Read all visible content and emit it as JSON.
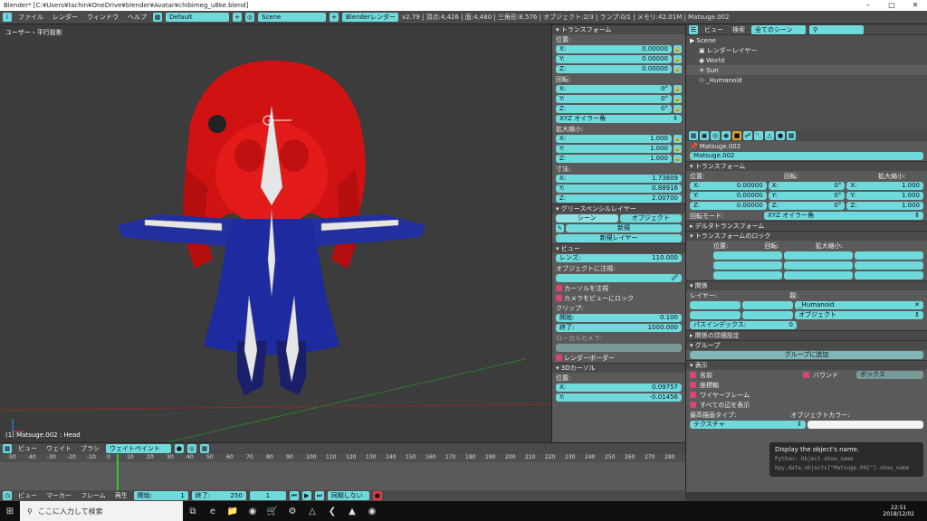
{
  "window": {
    "title": "Blender* [C:¥Users¥tachin¥OneDrive¥blender¥Avatar¥chibimeg_u8ke.blend]"
  },
  "topbar": {
    "menus": [
      "ファイル",
      "レンダー",
      "ウィンドウ",
      "ヘルプ"
    ],
    "layout": "Default",
    "scene": "Scene",
    "engine": "Blenderレンダー",
    "stats": "v2.79 | 頂点:4,426 | 面:4,480 | 三角形:8,576 | オブジェクト:2/3 | ランプ:0/1 | メモリ:42.01M | Matsuge.002"
  },
  "viewport": {
    "label": "ユーザー・平行投影",
    "object": "(1) Matsuge.002 : Head"
  },
  "npanel": {
    "transform_title": "トランスフォーム",
    "location_label": "位置:",
    "location": [
      {
        "axis": "X:",
        "value": "0.00000"
      },
      {
        "axis": "Y:",
        "value": "0.00000"
      },
      {
        "axis": "Z:",
        "value": "0.00000"
      }
    ],
    "rotation_label": "回転:",
    "rotation": [
      {
        "axis": "X:",
        "value": "0°"
      },
      {
        "axis": "Y:",
        "value": "0°"
      },
      {
        "axis": "Z:",
        "value": "0°"
      }
    ],
    "rotation_mode": "XYZ オイラー角",
    "scale_label": "拡大縮小:",
    "scale": [
      {
        "axis": "X:",
        "value": "1.000"
      },
      {
        "axis": "Y:",
        "value": "1.000"
      },
      {
        "axis": "Z:",
        "value": "1.000"
      }
    ],
    "dim_label": "寸法:",
    "dims": [
      {
        "axis": "X:",
        "value": "1.73809"
      },
      {
        "axis": "Y:",
        "value": "0.88916"
      },
      {
        "axis": "Z:",
        "value": "2.00700"
      }
    ],
    "gp_title": "グリースペンシルレイヤー",
    "gp_tabs": [
      "シーン",
      "オブジェクト"
    ],
    "gp_new": "新規",
    "gp_new_layer": "新規レイヤー",
    "view_title": "ビュー",
    "lens_label": "レンズ:",
    "lens_value": "110.000",
    "focus_label": "オブジェクトに注視:",
    "lock_cursor": "カーソルを注視",
    "lock_camera": "カメラをビューにロック",
    "clip_label": "クリップ:",
    "clip_start_label": "開始:",
    "clip_start": "0.100",
    "clip_end_label": "終了:",
    "clip_end": "1000.000",
    "local_cam": "ローカルカメラ:",
    "render_border": "レンダーボーダー",
    "cursor_title": "3Dカーソル",
    "cursor_loc_label": "位置:",
    "cursor": [
      {
        "axis": "X:",
        "value": "0.09757"
      },
      {
        "axis": "Y:",
        "value": "-0.01456"
      }
    ]
  },
  "outliner": {
    "view": "ビュー",
    "search_label": "検索",
    "filter": "全てのシーン",
    "items": [
      "Scene",
      "レンダーレイヤー",
      "World",
      "Sun",
      "_Humanoid"
    ]
  },
  "props": {
    "object_name": "Matsuge.002",
    "breadcrumb": "Matsuge.002",
    "transform_title": "トランスフォーム",
    "col_loc": "位置:",
    "col_rot": "回転:",
    "col_scale": "拡大縮小:",
    "loc": [
      "0.00000",
      "0.00000",
      "0.00000"
    ],
    "rot": [
      "0°",
      "0°",
      "0°"
    ],
    "scale": [
      "1.000",
      "1.000",
      "1.000"
    ],
    "axes": [
      "X:",
      "Y:",
      "Z:"
    ],
    "rot_mode_label": "回転モード:",
    "rot_mode": "XYZ オイラー角",
    "delta_title": "デルタトランスフォーム",
    "lock_title": "トランスフォームのロック",
    "lock_loc": "位置:",
    "lock_rot": "回転:",
    "lock_scale": "拡大縮小:",
    "rel_title": "関係",
    "layer_label": "レイヤー:",
    "parent_label": "親:",
    "parent": "_Humanoid",
    "parent_type": "オブジェクト",
    "pass_index": "パスインデックス:",
    "pass_value": "0",
    "rel_extra": "関係の詳細設定",
    "group_title": "グループ",
    "group_add": "グループに追加",
    "display_title": "表示",
    "name_cb": "名前",
    "axis_cb": "座標軸",
    "wire_cb": "ワイヤーフレーム",
    "alledges_cb": "すべての辺を表示",
    "bounds_cb": "バウンド",
    "bounds_type": "ボックス",
    "max_draw": "最高描画タイプ:",
    "draw_type": "テクスチャ",
    "obj_color": "オブジェクトカラー:"
  },
  "tooltip": {
    "text": "Display the object's name.",
    "python1": "Python: Object.show_name",
    "python2": "bpy.data.objects[\"Matsuge.002\"].show_name"
  },
  "viewport_header": {
    "menus": [
      "ビュー",
      "ウェイト",
      "ブラシ"
    ],
    "mode": "ウェイトペイント"
  },
  "timeline": {
    "ticks": [
      "-50",
      "-40",
      "-30",
      "-20",
      "-10",
      "0",
      "10",
      "20",
      "30",
      "40",
      "50",
      "60",
      "70",
      "80",
      "90",
      "100",
      "110",
      "120",
      "130",
      "140",
      "150",
      "160",
      "170",
      "180",
      "190",
      "200",
      "210",
      "220",
      "230",
      "240",
      "250",
      "260",
      "270",
      "280"
    ],
    "menus": [
      "ビュー",
      "マーカー",
      "フレーム",
      "再生"
    ],
    "start_label": "開始:",
    "start": "1",
    "end_label": "終了:",
    "end": "250",
    "current": "1",
    "sync": "同期しない"
  },
  "taskbar": {
    "search_placeholder": "ここに入力して検索",
    "time": "22:51",
    "date": "2018/12/02"
  }
}
